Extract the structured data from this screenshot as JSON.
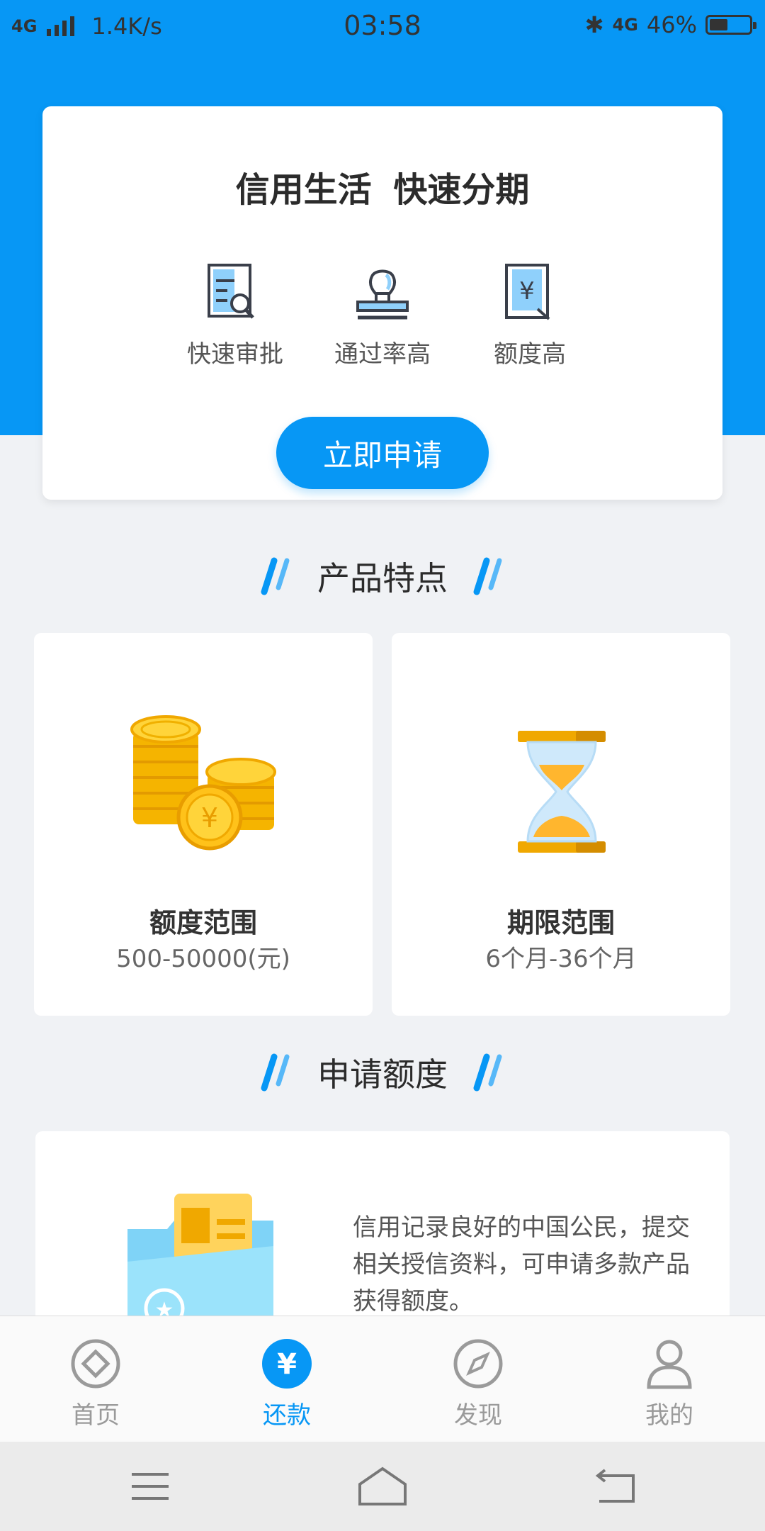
{
  "status_bar": {
    "network": "4G",
    "speed": "1.4K/s",
    "time": "03:58",
    "right_network": "4G",
    "battery": "46%",
    "battery_level": 0.46
  },
  "hero": {
    "title": "信用生活  快速分期",
    "features": [
      {
        "label": "快速审批",
        "icon": "document-search-icon"
      },
      {
        "label": "通过率高",
        "icon": "stamp-icon"
      },
      {
        "label": "额度高",
        "icon": "yen-document-icon"
      }
    ],
    "apply_button": "立即申请"
  },
  "section_features": {
    "title": "产品特点"
  },
  "product_cards": [
    {
      "title": "额度范围",
      "subtitle": "500-50000(元)",
      "icon": "gold-coins-icon"
    },
    {
      "title": "期限范围",
      "subtitle": "6个月-36个月",
      "icon": "hourglass-icon"
    }
  ],
  "section_apply": {
    "title": "申请额度"
  },
  "apply_card": {
    "description": "信用记录良好的中国公民，提交相关授信资料，可申请多款产品获得额度。",
    "icon": "folder-document-icon"
  },
  "tab_bar": {
    "items": [
      {
        "label": "首页",
        "icon": "diamond-home-icon",
        "active": false
      },
      {
        "label": "还款",
        "icon": "yen-circle-icon",
        "active": true
      },
      {
        "label": "发现",
        "icon": "compass-icon",
        "active": false
      },
      {
        "label": "我的",
        "icon": "person-icon",
        "active": false
      }
    ]
  },
  "nav_bar": {
    "buttons": [
      "menu-icon",
      "home-icon",
      "back-icon"
    ]
  },
  "colors": {
    "primary": "#0797f5",
    "background": "#f0f2f5",
    "gold": "#f5b400"
  }
}
